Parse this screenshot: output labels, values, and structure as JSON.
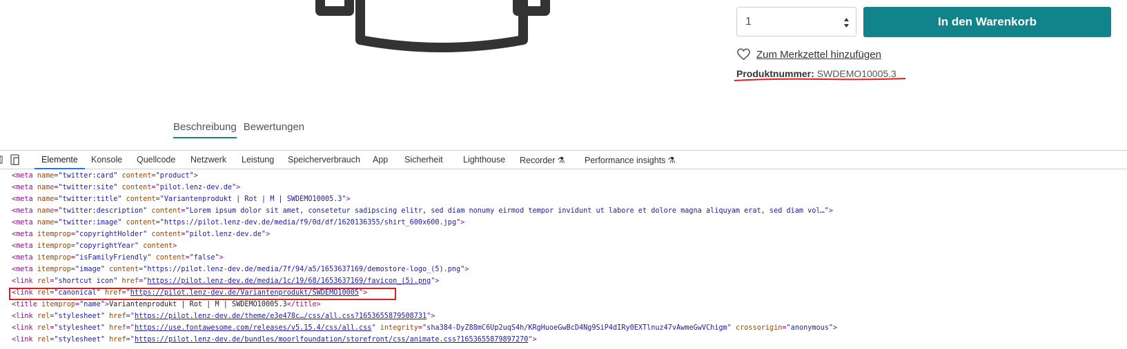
{
  "product": {
    "quantity_value": "1",
    "add_to_cart_label": "In den Warenkorb",
    "wishlist_label": "Zum Merkzettel hinzufügen",
    "product_number_label": "Produktnummer:",
    "product_number_value": "SWDEMO10005.3",
    "accent_color": "#10848a",
    "annotation_color": "#e31b1b"
  },
  "tabs": {
    "description": "Beschreibung",
    "reviews": "Bewertungen"
  },
  "devtools": {
    "tabs": [
      "Elemente",
      "Konsole",
      "Quellcode",
      "Netzwerk",
      "Leistung",
      "Speicherverbrauch",
      "App",
      "Sicherheit",
      "Lighthouse",
      "Recorder",
      "Performance insights"
    ],
    "active_tab": "Elemente",
    "lines": [
      {
        "parts": [
          [
            "t",
            "<meta "
          ],
          [
            "n",
            "name"
          ],
          [
            "t",
            "="
          ],
          [
            "v",
            "\"twitter:card\""
          ],
          [
            "t",
            " "
          ],
          [
            "n",
            "content"
          ],
          [
            "t",
            "="
          ],
          [
            "v",
            "\"product\""
          ],
          [
            "t",
            ">"
          ]
        ]
      },
      {
        "parts": [
          [
            "t",
            "<meta "
          ],
          [
            "n",
            "name"
          ],
          [
            "t",
            "="
          ],
          [
            "v",
            "\"twitter:site\""
          ],
          [
            "t",
            " "
          ],
          [
            "n",
            "content"
          ],
          [
            "t",
            "="
          ],
          [
            "v",
            "\"pilot.lenz-dev.de\""
          ],
          [
            "t",
            ">"
          ]
        ]
      },
      {
        "parts": [
          [
            "t",
            "<meta "
          ],
          [
            "n",
            "name"
          ],
          [
            "t",
            "="
          ],
          [
            "v",
            "\"twitter:title\""
          ],
          [
            "t",
            " "
          ],
          [
            "n",
            "content"
          ],
          [
            "t",
            "="
          ],
          [
            "v",
            "\"Variantenprodukt | Rot | M | SWDEMO10005.3\""
          ],
          [
            "t",
            ">"
          ]
        ]
      },
      {
        "parts": [
          [
            "t",
            "<meta "
          ],
          [
            "n",
            "name"
          ],
          [
            "t",
            "="
          ],
          [
            "v",
            "\"twitter:description\""
          ],
          [
            "t",
            " "
          ],
          [
            "n",
            "content"
          ],
          [
            "t",
            "="
          ],
          [
            "v",
            "\"Lorem ipsum dolor sit amet, consetetur sadipscing elitr, sed diam nonumy eirmod tempor invidunt ut labore et dolore magna aliquyam erat, sed diam vol…\""
          ],
          [
            "t",
            ">"
          ]
        ]
      },
      {
        "parts": [
          [
            "t",
            "<meta "
          ],
          [
            "n",
            "name"
          ],
          [
            "t",
            "="
          ],
          [
            "v",
            "\"twitter:image\""
          ],
          [
            "t",
            " "
          ],
          [
            "n",
            "content"
          ],
          [
            "t",
            "="
          ],
          [
            "v",
            "\"https://pilot.lenz-dev.de/media/f9/0d/df/1620136355/shirt_600x600.jpg\""
          ],
          [
            "t",
            ">"
          ]
        ]
      },
      {
        "parts": [
          [
            "t",
            "<meta "
          ],
          [
            "n",
            "itemprop"
          ],
          [
            "t",
            "="
          ],
          [
            "v",
            "\"copyrightHolder\""
          ],
          [
            "t",
            " "
          ],
          [
            "n",
            "content"
          ],
          [
            "t",
            "="
          ],
          [
            "v",
            "\"pilot.lenz-dev.de\""
          ],
          [
            "t",
            ">"
          ]
        ]
      },
      {
        "parts": [
          [
            "t",
            "<meta "
          ],
          [
            "n",
            "itemprop"
          ],
          [
            "t",
            "="
          ],
          [
            "v",
            "\"copyrightYear\""
          ],
          [
            "t",
            " "
          ],
          [
            "n",
            "content"
          ],
          [
            "t",
            ">"
          ]
        ]
      },
      {
        "parts": [
          [
            "t",
            "<meta "
          ],
          [
            "n",
            "itemprop"
          ],
          [
            "t",
            "="
          ],
          [
            "v",
            "\"isFamilyFriendly\""
          ],
          [
            "t",
            " "
          ],
          [
            "n",
            "content"
          ],
          [
            "t",
            "="
          ],
          [
            "v",
            "\"false\""
          ],
          [
            "t",
            ">"
          ]
        ]
      },
      {
        "parts": [
          [
            "t",
            "<meta "
          ],
          [
            "n",
            "itemprop"
          ],
          [
            "t",
            "="
          ],
          [
            "v",
            "\"image\""
          ],
          [
            "t",
            " "
          ],
          [
            "n",
            "content"
          ],
          [
            "t",
            "="
          ],
          [
            "v",
            "\"https://pilot.lenz-dev.de/media/7f/94/a5/1653637169/demostore-logo_(5).png\""
          ],
          [
            "t",
            ">"
          ]
        ]
      },
      {
        "parts": [
          [
            "t",
            "<link "
          ],
          [
            "n",
            "rel"
          ],
          [
            "t",
            "="
          ],
          [
            "v",
            "\"shortcut icon\""
          ],
          [
            "t",
            " "
          ],
          [
            "n",
            "href"
          ],
          [
            "t",
            "=\""
          ],
          [
            "l",
            "https://pilot.lenz-dev.de/media/1c/19/68/1653637169/favicon_(5).png"
          ],
          [
            "t",
            "\">"
          ]
        ]
      },
      {
        "parts": [
          [
            "t",
            "<link "
          ],
          [
            "n",
            "rel"
          ],
          [
            "t",
            "="
          ],
          [
            "v",
            "\"canonical\""
          ],
          [
            "t",
            " "
          ],
          [
            "n",
            "href"
          ],
          [
            "t",
            "=\""
          ],
          [
            "l",
            "https://pilot.lenz-dev.de/Variantenprodukt/SWDEMO10005"
          ],
          [
            "t",
            "\">"
          ]
        ]
      },
      {
        "parts": [
          [
            "t",
            "<title "
          ],
          [
            "n",
            "itemprop"
          ],
          [
            "t",
            "="
          ],
          [
            "v",
            "\"name\""
          ],
          [
            "t",
            ">"
          ],
          [
            "x",
            "Variantenprodukt | Rot | M | SWDEMO10005.3"
          ],
          [
            "t",
            "</title>"
          ]
        ]
      },
      {
        "parts": [
          [
            "t",
            "<link "
          ],
          [
            "n",
            "rel"
          ],
          [
            "t",
            "="
          ],
          [
            "v",
            "\"stylesheet\""
          ],
          [
            "t",
            " "
          ],
          [
            "n",
            "href"
          ],
          [
            "t",
            "=\""
          ],
          [
            "l",
            "https://pilot.lenz-dev.de/theme/e3e478c…/css/all.css?1653655879508731"
          ],
          [
            "t",
            "\">"
          ]
        ]
      },
      {
        "parts": [
          [
            "t",
            "<link "
          ],
          [
            "n",
            "rel"
          ],
          [
            "t",
            "="
          ],
          [
            "v",
            "\"stylesheet\""
          ],
          [
            "t",
            " "
          ],
          [
            "n",
            "href"
          ],
          [
            "t",
            "=\""
          ],
          [
            "l",
            "https://use.fontawesome.com/releases/v5.15.4/css/all.css"
          ],
          [
            "t",
            "\" "
          ],
          [
            "n",
            "integrity"
          ],
          [
            "t",
            "="
          ],
          [
            "v",
            "\"sha384-DyZ88mC6Up2uqS4h/KRgHuoeGwBcD4Ng9SiP4dIRy0EXTlnuz47vAwmeGwVChigm\""
          ],
          [
            "t",
            " "
          ],
          [
            "n",
            "crossorigin"
          ],
          [
            "t",
            "="
          ],
          [
            "v",
            "\"anonymous\""
          ],
          [
            "t",
            ">"
          ]
        ]
      },
      {
        "parts": [
          [
            "t",
            "<link "
          ],
          [
            "n",
            "rel"
          ],
          [
            "t",
            "="
          ],
          [
            "v",
            "\"stylesheet\""
          ],
          [
            "t",
            " "
          ],
          [
            "n",
            "href"
          ],
          [
            "t",
            "=\""
          ],
          [
            "l",
            "https://pilot.lenz-dev.de/bundles/moorlfoundation/storefront/css/animate.css?1653655879897270"
          ],
          [
            "t",
            "\">"
          ]
        ]
      }
    ]
  }
}
